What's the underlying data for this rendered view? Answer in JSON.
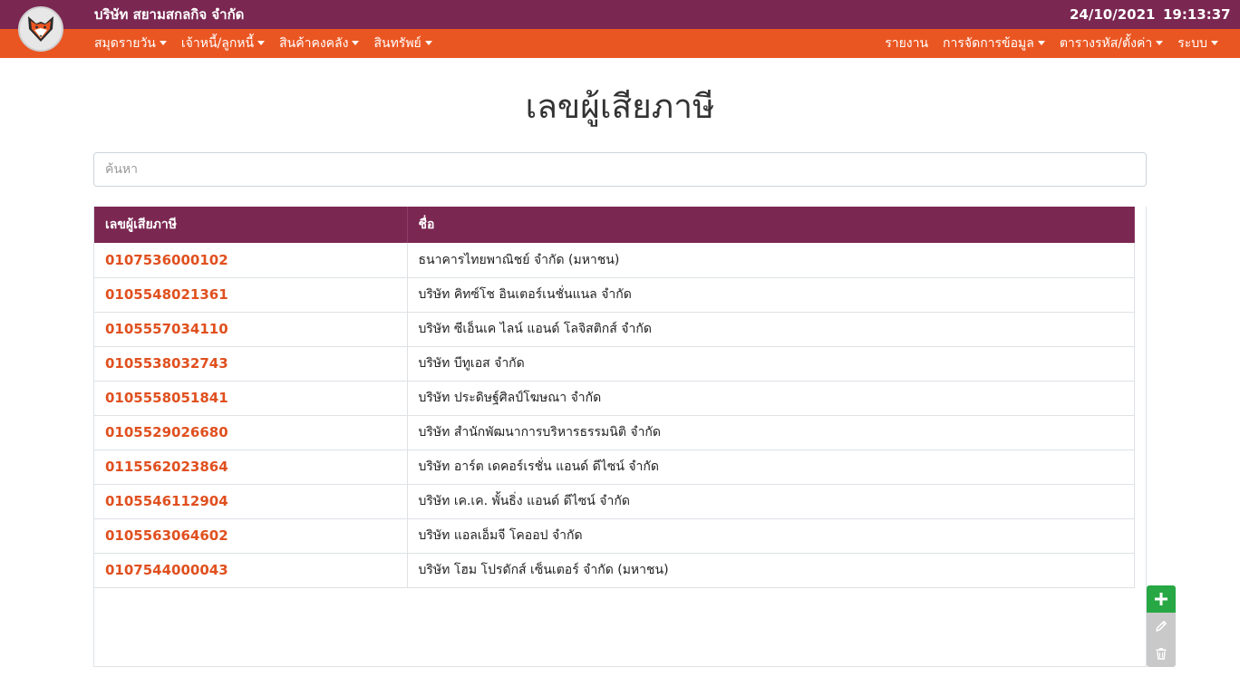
{
  "header": {
    "company_name": "บริษัท สยามสกลกิจ จำกัด",
    "date": "24/10/2021",
    "time": "19:13:37"
  },
  "nav": {
    "left": [
      {
        "label": "สมุดรายวัน",
        "dropdown": true
      },
      {
        "label": "เจ้าหนี้/ลูกหนี้",
        "dropdown": true
      },
      {
        "label": "สินค้าคงคลัง",
        "dropdown": true
      },
      {
        "label": "สินทรัพย์",
        "dropdown": true
      }
    ],
    "right": [
      {
        "label": "รายงาน",
        "dropdown": false
      },
      {
        "label": "การจัดการข้อมูล",
        "dropdown": true
      },
      {
        "label": "ตารางรหัส/ตั้งค่า",
        "dropdown": true
      },
      {
        "label": "ระบบ",
        "dropdown": true
      }
    ]
  },
  "page": {
    "title": "เลขผู้เสียภาษี"
  },
  "search": {
    "placeholder": "ค้นหา",
    "value": ""
  },
  "table": {
    "columns": [
      "เลขผู้เสียภาษี",
      "ชื่อ"
    ],
    "rows": [
      {
        "tax_id": "0107536000102",
        "name": "ธนาคารไทยพาณิชย์ จำกัด (มหาชน)"
      },
      {
        "tax_id": "0105548021361",
        "name": "บริษัท คิทซ์โช อินเตอร์เนชั่นแนล จำกัด"
      },
      {
        "tax_id": "0105557034110",
        "name": "บริษัท ซีเอ็นเค ไลน์ แอนด์ โลจิสติกส์ จำกัด"
      },
      {
        "tax_id": "0105538032743",
        "name": "บริษัท บีทูเอส จำกัด"
      },
      {
        "tax_id": "0105558051841",
        "name": "บริษัท ประดิษฐ์ศิลป์โฆษณา จำกัด"
      },
      {
        "tax_id": "0105529026680",
        "name": "บริษัท สำนักพัฒนาการบริหารธรรมนิติ จำกัด"
      },
      {
        "tax_id": "0115562023864",
        "name": "บริษัท อาร์ต เดคอร์เรชั่น แอนด์ ดีไซน์ จำกัด"
      },
      {
        "tax_id": "0105546112904",
        "name": "บริษัท เค.เค. พั้นธิ่ง แอนด์ ดีไซน์ จำกัด"
      },
      {
        "tax_id": "0105563064602",
        "name": "บริษัท แอลเอ็มจี โคออป จำกัด"
      },
      {
        "tax_id": "0107544000043",
        "name": "บริษัท โฮม โปรดักส์ เซ็นเตอร์ จำกัด (มหาชน)"
      }
    ]
  },
  "colors": {
    "primary": "#7a2752",
    "accent": "#ea5622",
    "add_button": "#27a844",
    "disabled_button": "#c9c9c9"
  },
  "icons": {
    "logo": "fox-logo-icon",
    "add": "plus-icon",
    "edit": "pencil-icon",
    "delete": "trash-icon"
  }
}
